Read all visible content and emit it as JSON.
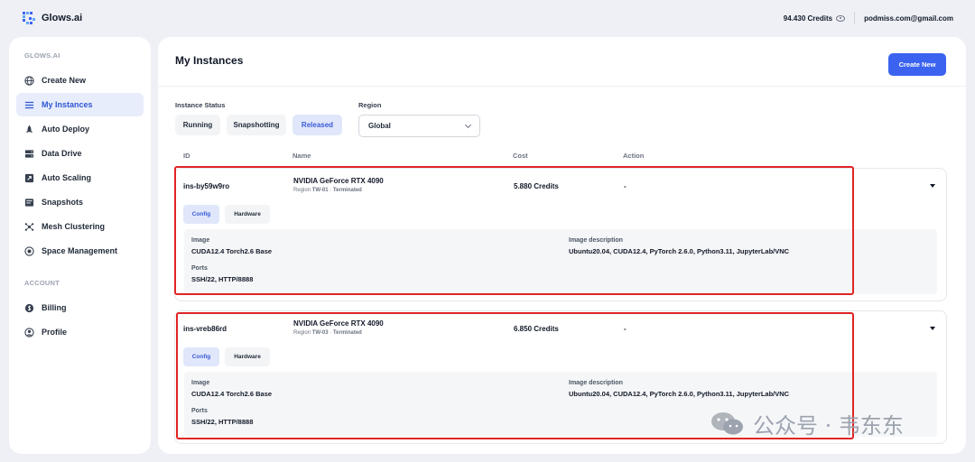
{
  "header": {
    "brand": "Glows.ai",
    "credits": "94.430 Credits",
    "email": "podmiss.com@gmail.com"
  },
  "sidebar": {
    "section_main": "GLOWS.AI",
    "items": [
      {
        "label": "Create New",
        "icon": "globe-icon"
      },
      {
        "label": "My Instances",
        "icon": "list-icon",
        "active": true
      },
      {
        "label": "Auto Deploy",
        "icon": "rocket-icon"
      },
      {
        "label": "Data Drive",
        "icon": "drive-icon"
      },
      {
        "label": "Auto Scaling",
        "icon": "scaling-icon"
      },
      {
        "label": "Snapshots",
        "icon": "snapshot-icon"
      },
      {
        "label": "Mesh Clustering",
        "icon": "cluster-icon"
      },
      {
        "label": "Space Management",
        "icon": "space-icon"
      }
    ],
    "section_account": "ACCOUNT",
    "account_items": [
      {
        "label": "Billing",
        "icon": "billing-icon"
      },
      {
        "label": "Profile",
        "icon": "profile-icon"
      }
    ]
  },
  "main": {
    "title": "My Instances",
    "create_button": "Create New",
    "status_label": "Instance Status",
    "status_options": [
      "Running",
      "Snapshotting",
      "Released"
    ],
    "status_selected": "Released",
    "region_label": "Region",
    "region_value": "Global",
    "columns": [
      "ID",
      "Name",
      "Cost",
      "Action"
    ],
    "instances": [
      {
        "id": "ins-by59w9ro",
        "gpu": "NVIDIA GeForce RTX 4090",
        "region_label": "Region",
        "region": "TW-01",
        "state": "Terminated",
        "cost": "5.880 Credits",
        "action": "-",
        "tabs": [
          "Config",
          "Hardware"
        ],
        "image_label": "Image",
        "image": "CUDA12.4 Torch2.6 Base",
        "desc_label": "Image description",
        "desc": "Ubuntu20.04, CUDA12.4, PyTorch 2.6.0, Python3.11, JupyterLab/VNC",
        "ports_label": "Ports",
        "ports": "SSH/22, HTTP/8888"
      },
      {
        "id": "ins-vreb86rd",
        "gpu": "NVIDIA GeForce RTX 4090",
        "region_label": "Region",
        "region": "TW-03",
        "state": "Terminated",
        "cost": "6.850 Credits",
        "action": "-",
        "tabs": [
          "Config",
          "Hardware"
        ],
        "image_label": "Image",
        "image": "CUDA12.4 Torch2.6 Base",
        "desc_label": "Image description",
        "desc": "Ubuntu20.04, CUDA12.4, PyTorch 2.6.0, Python3.11, JupyterLab/VNC",
        "ports_label": "Ports",
        "ports": "SSH/22, HTTP/8888"
      }
    ]
  },
  "watermark": {
    "text": "公众号 · 韦东东",
    "icon": "wechat-icon"
  },
  "colors": {
    "accent": "#3b63f0",
    "highlight": "#e02424",
    "active_bg": "#e8edfb"
  }
}
